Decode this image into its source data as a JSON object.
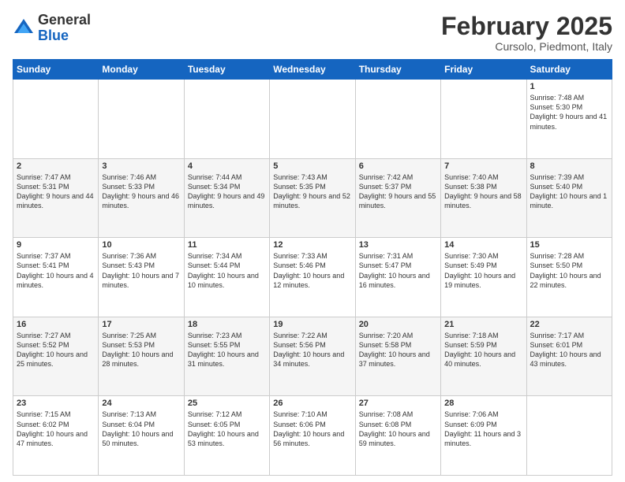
{
  "logo": {
    "general": "General",
    "blue": "Blue"
  },
  "header": {
    "month_year": "February 2025",
    "location": "Cursolo, Piedmont, Italy"
  },
  "weekdays": [
    "Sunday",
    "Monday",
    "Tuesday",
    "Wednesday",
    "Thursday",
    "Friday",
    "Saturday"
  ],
  "weeks": [
    [
      {
        "day": "",
        "info": ""
      },
      {
        "day": "",
        "info": ""
      },
      {
        "day": "",
        "info": ""
      },
      {
        "day": "",
        "info": ""
      },
      {
        "day": "",
        "info": ""
      },
      {
        "day": "",
        "info": ""
      },
      {
        "day": "1",
        "info": "Sunrise: 7:48 AM\nSunset: 5:30 PM\nDaylight: 9 hours and 41 minutes."
      }
    ],
    [
      {
        "day": "2",
        "info": "Sunrise: 7:47 AM\nSunset: 5:31 PM\nDaylight: 9 hours and 44 minutes."
      },
      {
        "day": "3",
        "info": "Sunrise: 7:46 AM\nSunset: 5:33 PM\nDaylight: 9 hours and 46 minutes."
      },
      {
        "day": "4",
        "info": "Sunrise: 7:44 AM\nSunset: 5:34 PM\nDaylight: 9 hours and 49 minutes."
      },
      {
        "day": "5",
        "info": "Sunrise: 7:43 AM\nSunset: 5:35 PM\nDaylight: 9 hours and 52 minutes."
      },
      {
        "day": "6",
        "info": "Sunrise: 7:42 AM\nSunset: 5:37 PM\nDaylight: 9 hours and 55 minutes."
      },
      {
        "day": "7",
        "info": "Sunrise: 7:40 AM\nSunset: 5:38 PM\nDaylight: 9 hours and 58 minutes."
      },
      {
        "day": "8",
        "info": "Sunrise: 7:39 AM\nSunset: 5:40 PM\nDaylight: 10 hours and 1 minute."
      }
    ],
    [
      {
        "day": "9",
        "info": "Sunrise: 7:37 AM\nSunset: 5:41 PM\nDaylight: 10 hours and 4 minutes."
      },
      {
        "day": "10",
        "info": "Sunrise: 7:36 AM\nSunset: 5:43 PM\nDaylight: 10 hours and 7 minutes."
      },
      {
        "day": "11",
        "info": "Sunrise: 7:34 AM\nSunset: 5:44 PM\nDaylight: 10 hours and 10 minutes."
      },
      {
        "day": "12",
        "info": "Sunrise: 7:33 AM\nSunset: 5:46 PM\nDaylight: 10 hours and 12 minutes."
      },
      {
        "day": "13",
        "info": "Sunrise: 7:31 AM\nSunset: 5:47 PM\nDaylight: 10 hours and 16 minutes."
      },
      {
        "day": "14",
        "info": "Sunrise: 7:30 AM\nSunset: 5:49 PM\nDaylight: 10 hours and 19 minutes."
      },
      {
        "day": "15",
        "info": "Sunrise: 7:28 AM\nSunset: 5:50 PM\nDaylight: 10 hours and 22 minutes."
      }
    ],
    [
      {
        "day": "16",
        "info": "Sunrise: 7:27 AM\nSunset: 5:52 PM\nDaylight: 10 hours and 25 minutes."
      },
      {
        "day": "17",
        "info": "Sunrise: 7:25 AM\nSunset: 5:53 PM\nDaylight: 10 hours and 28 minutes."
      },
      {
        "day": "18",
        "info": "Sunrise: 7:23 AM\nSunset: 5:55 PM\nDaylight: 10 hours and 31 minutes."
      },
      {
        "day": "19",
        "info": "Sunrise: 7:22 AM\nSunset: 5:56 PM\nDaylight: 10 hours and 34 minutes."
      },
      {
        "day": "20",
        "info": "Sunrise: 7:20 AM\nSunset: 5:58 PM\nDaylight: 10 hours and 37 minutes."
      },
      {
        "day": "21",
        "info": "Sunrise: 7:18 AM\nSunset: 5:59 PM\nDaylight: 10 hours and 40 minutes."
      },
      {
        "day": "22",
        "info": "Sunrise: 7:17 AM\nSunset: 6:01 PM\nDaylight: 10 hours and 43 minutes."
      }
    ],
    [
      {
        "day": "23",
        "info": "Sunrise: 7:15 AM\nSunset: 6:02 PM\nDaylight: 10 hours and 47 minutes."
      },
      {
        "day": "24",
        "info": "Sunrise: 7:13 AM\nSunset: 6:04 PM\nDaylight: 10 hours and 50 minutes."
      },
      {
        "day": "25",
        "info": "Sunrise: 7:12 AM\nSunset: 6:05 PM\nDaylight: 10 hours and 53 minutes."
      },
      {
        "day": "26",
        "info": "Sunrise: 7:10 AM\nSunset: 6:06 PM\nDaylight: 10 hours and 56 minutes."
      },
      {
        "day": "27",
        "info": "Sunrise: 7:08 AM\nSunset: 6:08 PM\nDaylight: 10 hours and 59 minutes."
      },
      {
        "day": "28",
        "info": "Sunrise: 7:06 AM\nSunset: 6:09 PM\nDaylight: 11 hours and 3 minutes."
      },
      {
        "day": "",
        "info": ""
      }
    ]
  ]
}
